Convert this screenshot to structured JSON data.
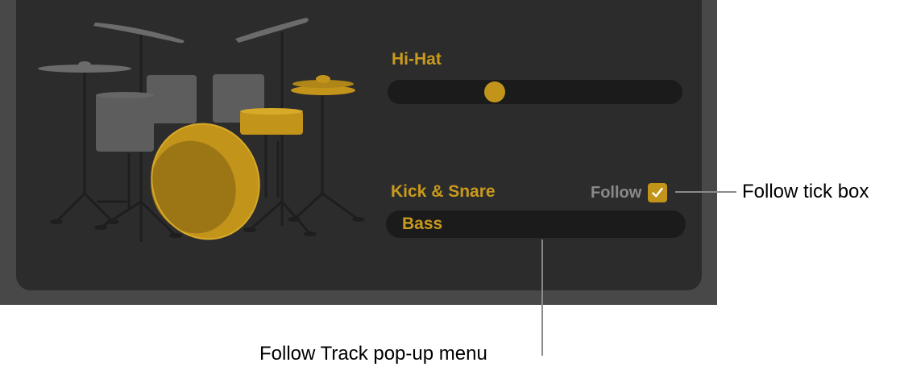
{
  "hihat": {
    "label": "Hi-Hat",
    "position": 0.35
  },
  "kick_snare": {
    "label": "Kick & Snare",
    "follow_label": "Follow",
    "follow_checked": true,
    "track_popup_value": "Bass"
  },
  "callouts": {
    "follow_tick_box": "Follow tick box",
    "follow_track_popup": "Follow Track pop-up menu"
  },
  "colors": {
    "accent": "#c3941a",
    "panel": "#2c2c2c",
    "frame": "#484848"
  },
  "icons": {
    "drum_kit": "drum-kit-icon",
    "checkmark": "checkmark-icon"
  }
}
